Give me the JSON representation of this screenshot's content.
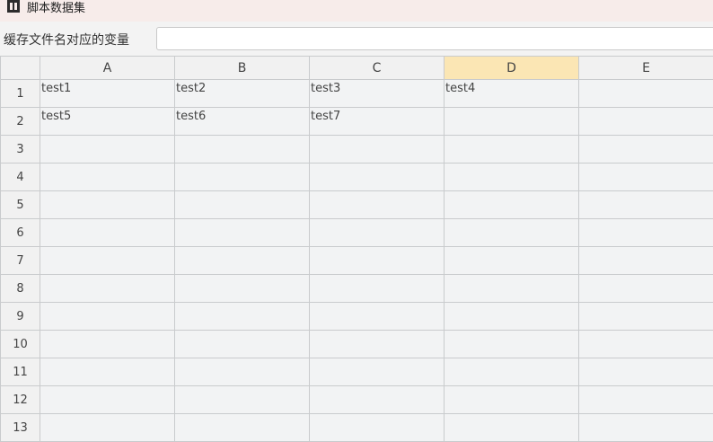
{
  "window": {
    "title": "脚本数据集",
    "icon": "app-icon"
  },
  "variable": {
    "label": "缓存文件名对应的变量",
    "value": "",
    "placeholder": ""
  },
  "sheet": {
    "columns": [
      "A",
      "B",
      "C",
      "D",
      "E"
    ],
    "active_column": "D",
    "rows": [
      {
        "num": "1",
        "cells": [
          "test1",
          "test2",
          "test3",
          "test4",
          ""
        ]
      },
      {
        "num": "2",
        "cells": [
          "test5",
          "test6",
          "test7",
          "",
          ""
        ]
      },
      {
        "num": "3",
        "cells": [
          "",
          "",
          "",
          "",
          ""
        ]
      },
      {
        "num": "4",
        "cells": [
          "",
          "",
          "",
          "",
          ""
        ]
      },
      {
        "num": "5",
        "cells": [
          "",
          "",
          "",
          "",
          ""
        ]
      },
      {
        "num": "6",
        "cells": [
          "",
          "",
          "",
          "",
          ""
        ]
      },
      {
        "num": "7",
        "cells": [
          "",
          "",
          "",
          "",
          ""
        ]
      },
      {
        "num": "8",
        "cells": [
          "",
          "",
          "",
          "",
          ""
        ]
      },
      {
        "num": "9",
        "cells": [
          "",
          "",
          "",
          "",
          ""
        ]
      },
      {
        "num": "10",
        "cells": [
          "",
          "",
          "",
          "",
          ""
        ]
      },
      {
        "num": "11",
        "cells": [
          "",
          "",
          "",
          "",
          ""
        ]
      },
      {
        "num": "12",
        "cells": [
          "",
          "",
          "",
          "",
          ""
        ]
      },
      {
        "num": "13",
        "cells": [
          "",
          "",
          "",
          "",
          ""
        ]
      }
    ]
  }
}
